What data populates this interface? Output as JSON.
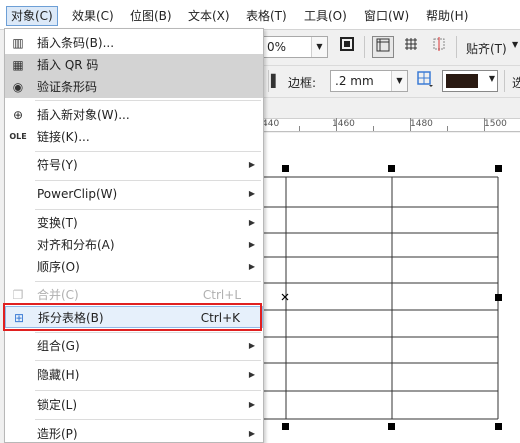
{
  "menubar": {
    "items": [
      {
        "label": "对象(C)",
        "active": true
      },
      {
        "label": "效果(C)"
      },
      {
        "label": "位图(B)"
      },
      {
        "label": "文本(X)"
      },
      {
        "label": "表格(T)"
      },
      {
        "label": "工具(O)"
      },
      {
        "label": "窗口(W)"
      },
      {
        "label": "帮助(H)"
      }
    ]
  },
  "toolbar1": {
    "zoom_value": "0%",
    "paste_label": "贴齐(T)"
  },
  "toolbar2": {
    "border_label": "边框:",
    "border_size": ".2 mm",
    "trailing_label": "选"
  },
  "ruler": {
    "labels": [
      "440",
      "1460",
      "1480",
      "1500"
    ]
  },
  "menu": {
    "items": [
      {
        "label": "插入条码(B)...",
        "icon": "barcode-icon",
        "glyph": "▥"
      },
      {
        "label": "插入 QR 码",
        "icon": "qr-code-icon",
        "glyph": "▦",
        "highlight": true
      },
      {
        "label": "验证条形码",
        "icon": "verify-barcode-icon",
        "glyph": "◉",
        "highlight": true
      },
      {
        "label": "插入新对象(W)...",
        "icon": "insert-object-icon",
        "glyph": "⊕"
      },
      {
        "label": "链接(K)...",
        "icon": "ole-link-icon",
        "glyph": "OLE"
      },
      {
        "label": "符号(Y)",
        "submenu": true
      },
      {
        "label": "PowerClip(W)",
        "submenu": true
      },
      {
        "label": "变换(T)",
        "submenu": true
      },
      {
        "label": "对齐和分布(A)",
        "submenu": true
      },
      {
        "label": "顺序(O)",
        "submenu": true
      },
      {
        "label": "合并(C)",
        "shortcut": "Ctrl+L",
        "disabled": true,
        "icon": "combine-icon",
        "glyph": "❐"
      },
      {
        "label": "拆分表格(B)",
        "shortcut": "Ctrl+K",
        "selected": true,
        "icon": "split-table-icon",
        "glyph": "⊞"
      },
      {
        "label": "组合(G)",
        "submenu": true
      },
      {
        "label": "隐藏(H)",
        "submenu": true
      },
      {
        "label": "锁定(L)",
        "submenu": true
      },
      {
        "label": "造形(P)",
        "submenu": true
      }
    ]
  }
}
